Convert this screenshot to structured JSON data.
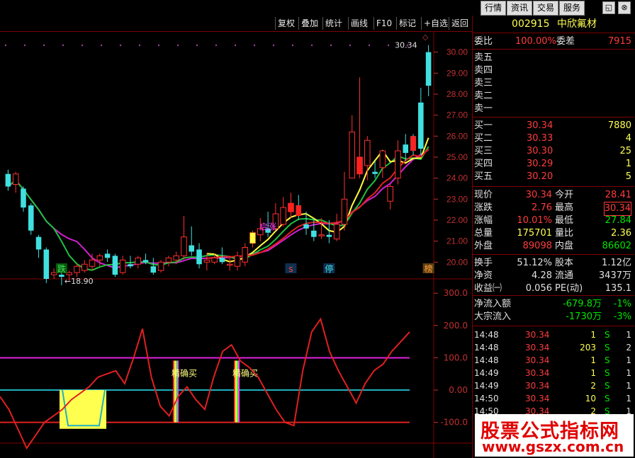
{
  "top_menu": [
    "行情",
    "资讯",
    "交易",
    "服务"
  ],
  "window_icons": [
    "restore-icon",
    "close-icon"
  ],
  "toolbar": [
    "复权",
    "叠加",
    "统计",
    "画线",
    "F10",
    "标记",
    "+自选",
    "返回"
  ],
  "stock": {
    "code": "002915",
    "name": "中欣氟材"
  },
  "weibi": {
    "label": "委比",
    "value": "100.00%",
    "label2": "委差",
    "value2": "7915"
  },
  "sell": [
    "卖五",
    "卖四",
    "卖三",
    "卖二",
    "卖一"
  ],
  "buy": [
    {
      "label": "买一",
      "price": "30.34",
      "vol": "7880"
    },
    {
      "label": "买二",
      "price": "30.33",
      "vol": "4"
    },
    {
      "label": "买三",
      "price": "30.30",
      "vol": "25"
    },
    {
      "label": "买四",
      "price": "30.29",
      "vol": "1"
    },
    {
      "label": "买五",
      "price": "30.20",
      "vol": "5"
    }
  ],
  "quote": [
    {
      "l1": "现价",
      "v1": "30.34",
      "l2": "今开",
      "v2": "28.41"
    },
    {
      "l1": "涨跌",
      "v1": "2.76",
      "l2": "最高",
      "v2": "30.34"
    },
    {
      "l1": "涨幅",
      "v1": "10.01%",
      "l2": "最低",
      "v2": "27.84"
    },
    {
      "l1": "总量",
      "v1": "175701",
      "l2": "量比",
      "v2": "2.36"
    },
    {
      "l1": "外盘",
      "v1": "89098",
      "l2": "内盘",
      "v2": "86602"
    }
  ],
  "fund": [
    {
      "l1": "换手",
      "v1": "51.12%",
      "l2": "股本",
      "v2": "1.12亿"
    },
    {
      "l1": "净资",
      "v1": "4.28",
      "l2": "流通",
      "v2": "3437万"
    },
    {
      "l1": "收益㈠",
      "v1": "0.056",
      "l2": "PE(动)",
      "v2": "135.1"
    }
  ],
  "flow": [
    {
      "label": "净流入额",
      "value": "-679.8万",
      "pct": "-1%"
    },
    {
      "label": "大宗流入",
      "value": "-1730万",
      "pct": "-3%"
    }
  ],
  "ticks": [
    {
      "time": "14:48",
      "price": "30.34",
      "vol": "1",
      "dir": "S",
      "n": "1"
    },
    {
      "time": "14:48",
      "price": "30.34",
      "vol": "203",
      "dir": "S",
      "n": "2"
    },
    {
      "time": "14:48",
      "price": "30.34",
      "vol": "1",
      "dir": "S",
      "n": "1"
    },
    {
      "time": "14:49",
      "price": "30.34",
      "vol": "1",
      "dir": "S",
      "n": "1"
    },
    {
      "time": "14:49",
      "price": "30.34",
      "vol": "2",
      "dir": "S",
      "n": "1"
    },
    {
      "time": "14:50",
      "price": "30.34",
      "vol": "10",
      "dir": "S",
      "n": "1"
    },
    {
      "time": "14:50",
      "price": "30.34",
      "vol": "2",
      "dir": "S",
      "n": "1"
    }
  ],
  "watermark": {
    "title": "股票公式指标网",
    "url": "www.gszx.com.cn"
  },
  "chart_data": [
    {
      "type": "candlestick",
      "y_ticks": [
        "30.00",
        "29.00",
        "28.00",
        "27.00",
        "26.00",
        "25.00",
        "24.00",
        "23.00",
        "22.00",
        "21.00",
        "20.00"
      ],
      "ylim": [
        19.2,
        31.0
      ],
      "last_label": "30.34",
      "low_label": "←18.90",
      "markers": [
        "跌",
        "启涨",
        "s",
        "停",
        "榜"
      ],
      "candles": [
        [
          24.2,
          24.4,
          23.4,
          23.6
        ],
        [
          23.7,
          24.3,
          23.3,
          24.2
        ],
        [
          23.5,
          23.6,
          22.4,
          22.6
        ],
        [
          22.7,
          22.8,
          21.3,
          21.5
        ],
        [
          21.2,
          21.3,
          20.2,
          20.6
        ],
        [
          20.6,
          20.7,
          19.0,
          19.2
        ],
        [
          19.4,
          19.7,
          19.2,
          19.5
        ],
        [
          19.4,
          19.5,
          18.9,
          19.3
        ],
        [
          19.4,
          19.6,
          19.1,
          19.5
        ],
        [
          19.5,
          19.9,
          19.3,
          19.8
        ],
        [
          19.6,
          20.1,
          19.5,
          19.9
        ],
        [
          19.8,
          20.4,
          19.6,
          20.1
        ],
        [
          20.1,
          20.4,
          19.8,
          20.3
        ],
        [
          20.4,
          20.6,
          20.0,
          20.2
        ],
        [
          20.3,
          20.4,
          19.3,
          19.4
        ],
        [
          19.5,
          20.3,
          19.4,
          20.1
        ],
        [
          19.9,
          20.3,
          19.7,
          19.8
        ],
        [
          19.9,
          20.3,
          19.7,
          20.2
        ],
        [
          20.1,
          20.4,
          19.9,
          20.0
        ],
        [
          19.8,
          20.2,
          19.4,
          19.5
        ],
        [
          19.6,
          20.1,
          19.5,
          20.0
        ],
        [
          20.0,
          20.3,
          19.8,
          20.2
        ],
        [
          20.1,
          20.5,
          19.9,
          20.3
        ],
        [
          20.3,
          22.2,
          20.1,
          21.2
        ],
        [
          20.8,
          21.7,
          20.3,
          20.5
        ],
        [
          20.6,
          20.9,
          19.7,
          19.9
        ],
        [
          20.0,
          20.4,
          19.6,
          20.1
        ],
        [
          20.0,
          20.4,
          19.9,
          20.2
        ],
        [
          20.2,
          20.7,
          19.9,
          20.0
        ],
        [
          19.9,
          20.3,
          19.6,
          19.9
        ],
        [
          19.8,
          20.5,
          19.6,
          20.3
        ],
        [
          20.0,
          20.9,
          19.8,
          20.7
        ],
        [
          20.9,
          21.5,
          20.7,
          21.4
        ],
        [
          21.3,
          22.1,
          21.0,
          21.6
        ],
        [
          21.6,
          22.4,
          21.2,
          21.4
        ],
        [
          21.6,
          22.8,
          21.5,
          22.3
        ],
        [
          21.8,
          23.1,
          21.7,
          22.6
        ],
        [
          22.4,
          23.3,
          22.1,
          22.8
        ],
        [
          22.7,
          23.2,
          22.0,
          22.2
        ],
        [
          21.8,
          22.4,
          21.3,
          21.6
        ],
        [
          21.5,
          22.1,
          21.0,
          21.2
        ],
        [
          21.3,
          22.1,
          21.1,
          21.3
        ],
        [
          21.3,
          22.0,
          20.9,
          21.2
        ],
        [
          21.1,
          22.3,
          21.0,
          21.8
        ],
        [
          21.8,
          24.3,
          21.5,
          23.0
        ],
        [
          24.0,
          27.0,
          24.0,
          26.2
        ],
        [
          24.2,
          28.8,
          24.0,
          25.0
        ],
        [
          24.6,
          26.0,
          23.9,
          25.8
        ],
        [
          24.3,
          24.8,
          24.0,
          24.2
        ],
        [
          24.5,
          25.2,
          24.0,
          25.3
        ],
        [
          22.9,
          23.7,
          22.5,
          23.6
        ],
        [
          24.0,
          25.8,
          23.7,
          25.3
        ],
        [
          25.6,
          26.1,
          24.8,
          25.2
        ],
        [
          26.0,
          26.1,
          25.1,
          25.3
        ],
        [
          27.6,
          28.3,
          25.1,
          25.4
        ],
        [
          30.0,
          30.34,
          27.9,
          28.4
        ]
      ]
    },
    {
      "type": "line",
      "y_ticks": [
        "300.0",
        "200.0",
        "100.0",
        "0.00",
        "-100.0"
      ],
      "ylim": [
        -160,
        340
      ],
      "labels": [
        "精确买",
        "精确买"
      ],
      "values": [
        -20,
        -60,
        -120,
        -180,
        -140,
        -100,
        -80,
        -60,
        -30,
        -10,
        10,
        40,
        50,
        60,
        20,
        100,
        190,
        40,
        -50,
        -80,
        -20,
        10,
        -30,
        -60,
        40,
        120,
        140,
        90,
        70,
        40,
        -10,
        -60,
        -100,
        -110,
        60,
        180,
        220,
        120,
        60,
        10,
        -40,
        20,
        60,
        80,
        120,
        150,
        180
      ]
    }
  ]
}
